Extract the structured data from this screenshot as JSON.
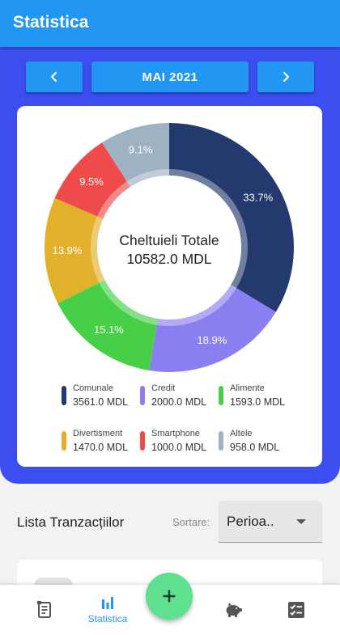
{
  "appbar": {
    "title": "Statistica"
  },
  "month_nav": {
    "prev_icon": "chevron-left-icon",
    "label": "MAI 2021",
    "next_icon": "chevron-right-icon"
  },
  "chart_data": {
    "type": "pie",
    "center_label": "Cheltuieli Totale",
    "center_value": "10582.0 MDL",
    "categories": [
      "Comunale",
      "Credit",
      "Alimente",
      "Divertisment",
      "Smartphone",
      "Altele"
    ],
    "values": [
      3561.0,
      2000.0,
      1593.0,
      1470.0,
      1000.0,
      958.0
    ],
    "percent_labels": [
      "33.7%",
      "18.9%",
      "15.1%",
      "13.9%",
      "9.5%",
      "9.1%"
    ],
    "colors": [
      "#243a6e",
      "#8a7ff0",
      "#47d047",
      "#e1b12c",
      "#ef4b4b",
      "#9fb2c3"
    ],
    "legend_placement": "bottom"
  },
  "legend": [
    {
      "name": "Comunale",
      "value": "3561.0 MDL",
      "color": "#243a6e"
    },
    {
      "name": "Credit",
      "value": "2000.0 MDL",
      "color": "#8a7ff0"
    },
    {
      "name": "Alimente",
      "value": "1593.0 MDL",
      "color": "#47d047"
    },
    {
      "name": "Divertisment",
      "value": "1470.0 MDL",
      "color": "#e1b12c"
    },
    {
      "name": "Smartphone",
      "value": "1000.0 MDL",
      "color": "#ef4b4b"
    },
    {
      "name": "Altele",
      "value": "958.0 MDL",
      "color": "#9fb2c3"
    }
  ],
  "transactions": {
    "title": "Lista Tranzacțiilor",
    "sort_label": "Sortare:",
    "sort_value": "Perioa.."
  },
  "bottom_nav": {
    "items": [
      {
        "icon": "receipt-icon",
        "label": ""
      },
      {
        "icon": "bar-chart-icon",
        "label": "Statistica",
        "active": true
      },
      {
        "icon": "piggy-bank-icon",
        "label": ""
      },
      {
        "icon": "checklist-icon",
        "label": ""
      }
    ],
    "fab_icon": "plus-icon"
  },
  "colors": {
    "appbar": "#2196f3",
    "panel": "#3d4ef0",
    "accent": "#2196f3",
    "fab": "#5ee08e"
  }
}
